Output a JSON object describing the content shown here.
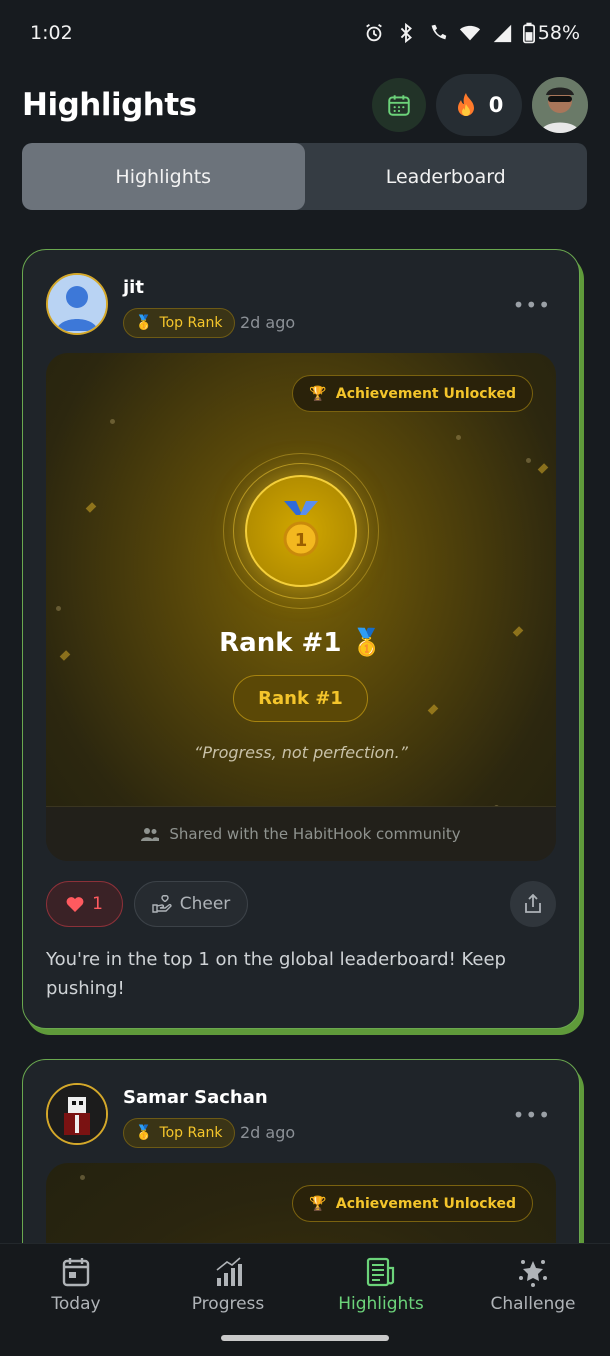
{
  "status": {
    "time": "1:02",
    "battery": "58%"
  },
  "header": {
    "title": "Highlights",
    "streak_count": "0"
  },
  "tabs": [
    {
      "label": "Highlights",
      "active": true
    },
    {
      "label": "Leaderboard",
      "active": false
    }
  ],
  "posts": [
    {
      "user": "jit",
      "badge": "Top Rank",
      "time_ago": "2d ago",
      "achievement_label": "Achievement Unlocked",
      "rank_title": "Rank #1",
      "rank_pill": "Rank #1",
      "quote": "“Progress, not perfection.”",
      "shared_text": "Shared with the HabitHook community",
      "likes": "1",
      "cheer_label": "Cheer",
      "body": "You're in the top 1 on the global leaderboard! Keep pushing!"
    },
    {
      "user": "Samar Sachan",
      "badge": "Top Rank",
      "time_ago": "2d ago",
      "achievement_label": "Achievement Unlocked"
    }
  ],
  "nav": [
    {
      "label": "Today",
      "icon": "calendar-icon",
      "active": false
    },
    {
      "label": "Progress",
      "icon": "bar-chart-icon",
      "active": false
    },
    {
      "label": "Highlights",
      "icon": "newspaper-icon",
      "active": true
    },
    {
      "label": "Challenge",
      "icon": "star-badge-icon",
      "active": false
    }
  ],
  "colors": {
    "accent": "#6cd37a",
    "gold": "#f4c52b",
    "card_border": "#6aa84f",
    "like": "#ff5a5f"
  }
}
